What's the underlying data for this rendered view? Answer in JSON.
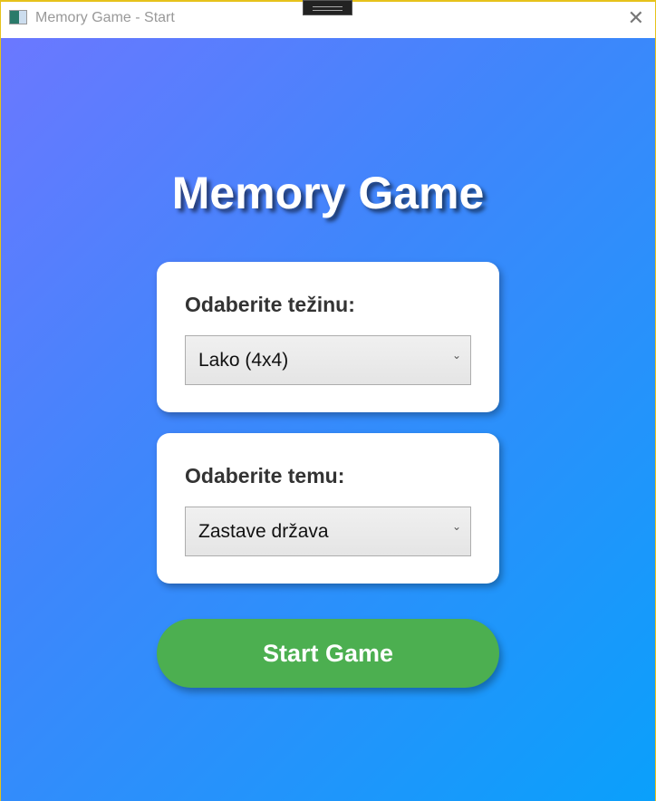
{
  "window": {
    "title": "Memory Game - Start"
  },
  "main": {
    "heading": "Memory Game",
    "difficulty": {
      "label": "Odaberite težinu:",
      "selected": "Lako (4x4)"
    },
    "theme": {
      "label": "Odaberite temu:",
      "selected": "Zastave država"
    },
    "start_label": "Start Game"
  },
  "colors": {
    "gradient_start": "#6b78ff",
    "gradient_end": "#0aa0fb",
    "start_button": "#4caf50"
  }
}
